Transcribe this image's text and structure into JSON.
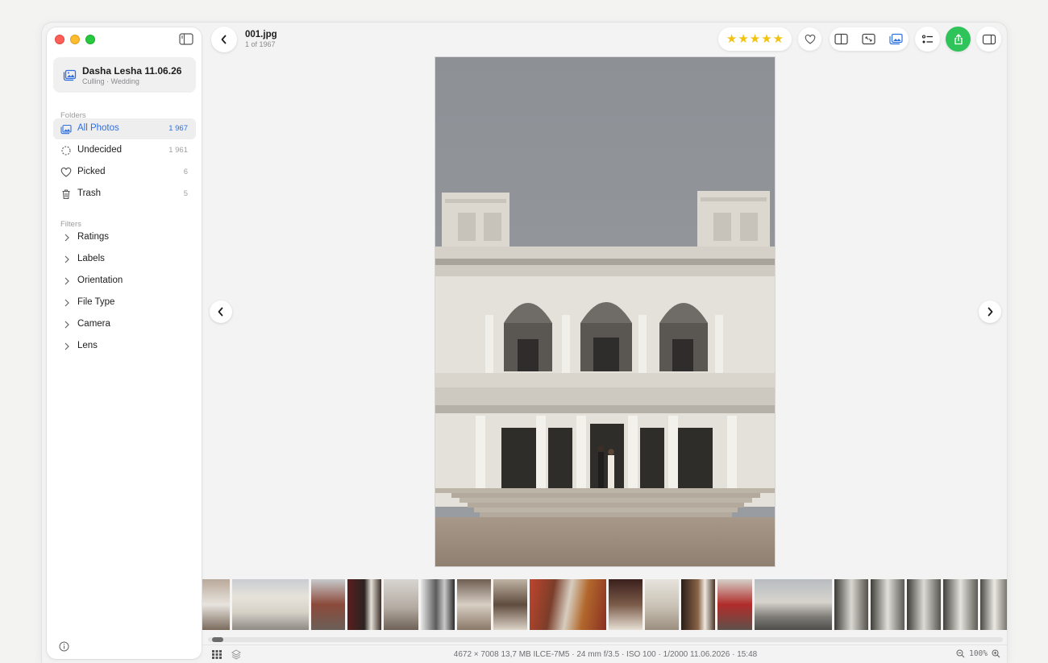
{
  "project": {
    "title": "Dasha Lesha 11.06.26",
    "subtitle": "Culling · Wedding"
  },
  "sidebar": {
    "folders_label": "Folders",
    "folders": [
      {
        "label": "All Photos",
        "count": "1 967",
        "active": true,
        "icon": "photos-icon"
      },
      {
        "label": "Undecided",
        "count": "1 961",
        "icon": "dashed-circle-icon"
      },
      {
        "label": "Picked",
        "count": "6",
        "icon": "heart-icon"
      },
      {
        "label": "Trash",
        "count": "5",
        "icon": "trash-icon"
      }
    ],
    "filters_label": "Filters",
    "filters": [
      "Ratings",
      "Labels",
      "Orientation",
      "File Type",
      "Camera",
      "Lens"
    ]
  },
  "viewer": {
    "file_name": "001.jpg",
    "file_index": "1 of 1967",
    "rating": 5
  },
  "status": {
    "meta": "4672 × 7008   13,7 MB   ILCE-7M5 · 24 mm   f/3.5 · ISO 100 · 1/2000   11.06.2026 · 15:48",
    "zoom": "100%"
  },
  "colors": {
    "accent": "#2f6fde",
    "star": "#f2c20e",
    "share": "#2ec45a"
  }
}
